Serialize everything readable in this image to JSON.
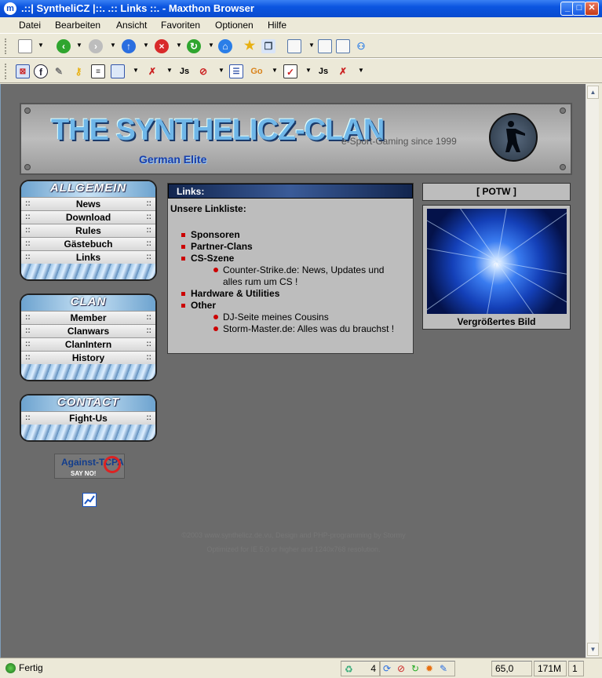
{
  "window": {
    "title": ".::| SyntheliCZ |::. .:: Links ::. - Maxthon Browser"
  },
  "menu": [
    "Datei",
    "Bearbeiten",
    "Ansicht",
    "Favoriten",
    "Optionen",
    "Hilfe"
  ],
  "site": {
    "logo": "THE SYNTHELICZ-CLAN",
    "logo_sub": "German Elite",
    "tagline": "e-Sport-Gaming since 1999",
    "nav_allgemein": {
      "header": "ALLGEMEIN",
      "items": [
        "News",
        "Download",
        "Rules",
        "Gästebuch",
        "Links"
      ]
    },
    "nav_clan": {
      "header": "CLAN",
      "items": [
        "Member",
        "Clanwars",
        "ClanIntern",
        "History"
      ]
    },
    "nav_contact": {
      "header": "CONTACT",
      "items": [
        "Fight-Us"
      ]
    },
    "nav_marker": "::",
    "links": {
      "title": "Links:",
      "intro": "Unsere Linkliste:",
      "cat_sponsoren": "Sponsoren",
      "cat_partner": "Partner-Clans",
      "cat_cs": "CS-Szene",
      "cs_item": "Counter-Strike.de: News, Updates und alles rum um CS !",
      "cat_hardware": "Hardware & Utilities",
      "cat_other": "Other",
      "other_items": [
        "DJ-Seite meines Cousins",
        "Storm-Master.de: Alles was du brauchst !"
      ]
    },
    "potw": {
      "title": "[ POTW ]",
      "caption": "Vergrößertes Bild"
    },
    "banner": {
      "top": "Against-TCPA",
      "bottom": "SAY NO!"
    },
    "footer_line1": "©2003 www.synthelicz.de.vu, Design and PHP-programming by Stormy",
    "footer_line2": "Optimized for IE 5.0 or higher and 1240x768 resolution."
  },
  "status": {
    "text": "Fertig",
    "count": "4",
    "size": "65,0 KB",
    "memory": "171M",
    "page": "1"
  }
}
